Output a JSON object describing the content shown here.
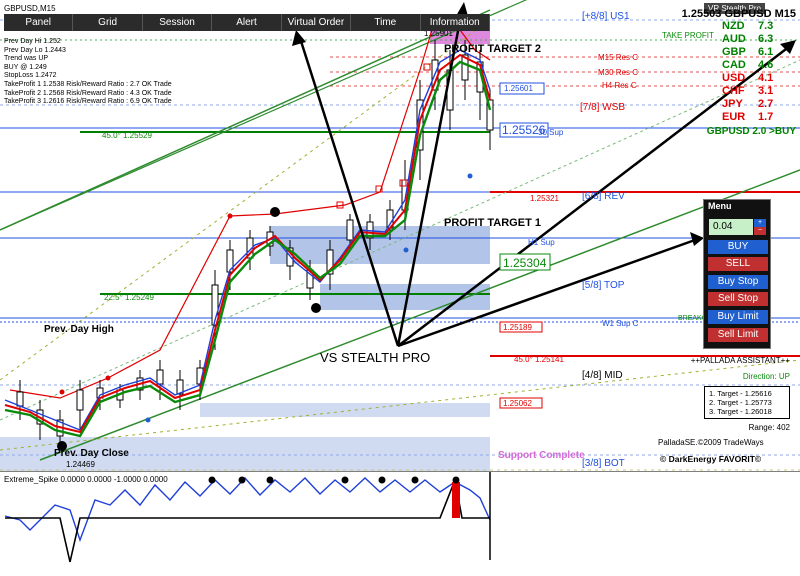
{
  "window": {
    "title": "GBPUSD,M15",
    "stealth_title": "VR Stealth Pro"
  },
  "toolbar": {
    "items": [
      "Panel",
      "Grid",
      "Session",
      "Alert",
      "Virtual Order",
      "Time",
      "Information"
    ]
  },
  "info": {
    "lines": [
      "Prev Day Hi 1.252",
      "Prev Day Lo 1.2443",
      "Trend was UP",
      "BUY @ 1.249",
      "StopLoss 1.2472",
      "TakeProfit 1 1.2538 Risk/Reward Ratio : 2.7 OK Trade",
      "TakeProfit 2 1.2568 Risk/Reward Ratio : 4.3 OK Trade",
      "TakeProfit 3 1.2616 Risk/Reward Ratio : 6.9 OK Trade"
    ]
  },
  "currency_panel": {
    "title": "1.25503 GBPUSD M15",
    "rows": [
      {
        "ccy": "NZD",
        "val": "7.3",
        "color": "#008000"
      },
      {
        "ccy": "AUD",
        "val": "6.3",
        "color": "#008000"
      },
      {
        "ccy": "GBP",
        "val": "6.1",
        "color": "#008000"
      },
      {
        "ccy": "CAD",
        "val": "4.6",
        "color": "#008000"
      },
      {
        "ccy": "USD",
        "val": "4.1",
        "color": "#e00000"
      },
      {
        "ccy": "CHF",
        "val": "3.1",
        "color": "#e00000"
      },
      {
        "ccy": "JPY",
        "val": "2.7",
        "color": "#e00000"
      },
      {
        "ccy": "EUR",
        "val": "1.7",
        "color": "#e00000"
      }
    ],
    "footer": "GBPUSD 2.0 >BUY"
  },
  "menu": {
    "title": "Menu",
    "lot_value": "0.04",
    "buttons": [
      "BUY",
      "SELL",
      "Buy Stop",
      "Sell Stop",
      "Buy Limit",
      "Sell Limit"
    ]
  },
  "assistant": {
    "title": "++PALLADA ASSISTANT++",
    "direction": "Direction: UP",
    "targets": [
      "1. Target - 1.25616",
      "2. Target - 1.25773",
      "3. Target - 1.26018"
    ],
    "range": "Range: 402",
    "credit": "PalladaSE.©2009 TradeWays",
    "favorit": "© DarkEnergy FAVORIT©"
  },
  "levels": {
    "m88": "[+8/8] US1",
    "m78": "[7/8]  WSB",
    "m68": "[6/8]  REV",
    "m58": "[5/8]  TOP",
    "m48": "[4/8]  MID",
    "m38": "[3/8]  BOT",
    "take_profit": "TAKE PROFIT",
    "m15_res": "M15 Res C",
    "m30_res": "M30 Res C",
    "h4_res": "H4 Res C",
    "h1_sup": "H1 Sup",
    "w1_sup": "W1 Sup C",
    "breakout": "BREAKOUT",
    "m30_sup": "30 Sup",
    "mid_label": "45.0° 1.25141",
    "angle_45": "45.0° 1.25529",
    "angle_225": "22.5° 1.25249",
    "price_25601": "1.25601",
    "price_25526": "1.25526",
    "price_25304": "1.25304",
    "price_25189": "1.25189",
    "price_25062": "1.25062",
    "price_25321": "1.25321"
  },
  "annotations": {
    "profit_target_2": "PROFIT TARGET 2",
    "profit_target_1": "PROFIT TARGET 1",
    "prev_day_high": "Prev. Day High",
    "prev_day_close": "Prev. Day Close",
    "stealth_pro": "VS STEALTH PRO",
    "support_complete": "Support Complete",
    "price_25901": "1.25901",
    "price_24469": "1.24469"
  },
  "sub_indicator": {
    "label": "Extreme_Spike 0.0000 0.0000 -1.0000 0.0000"
  },
  "colors": {
    "buy": "#1f5fd0",
    "sell": "#e00000",
    "accent_green": "#008000"
  }
}
